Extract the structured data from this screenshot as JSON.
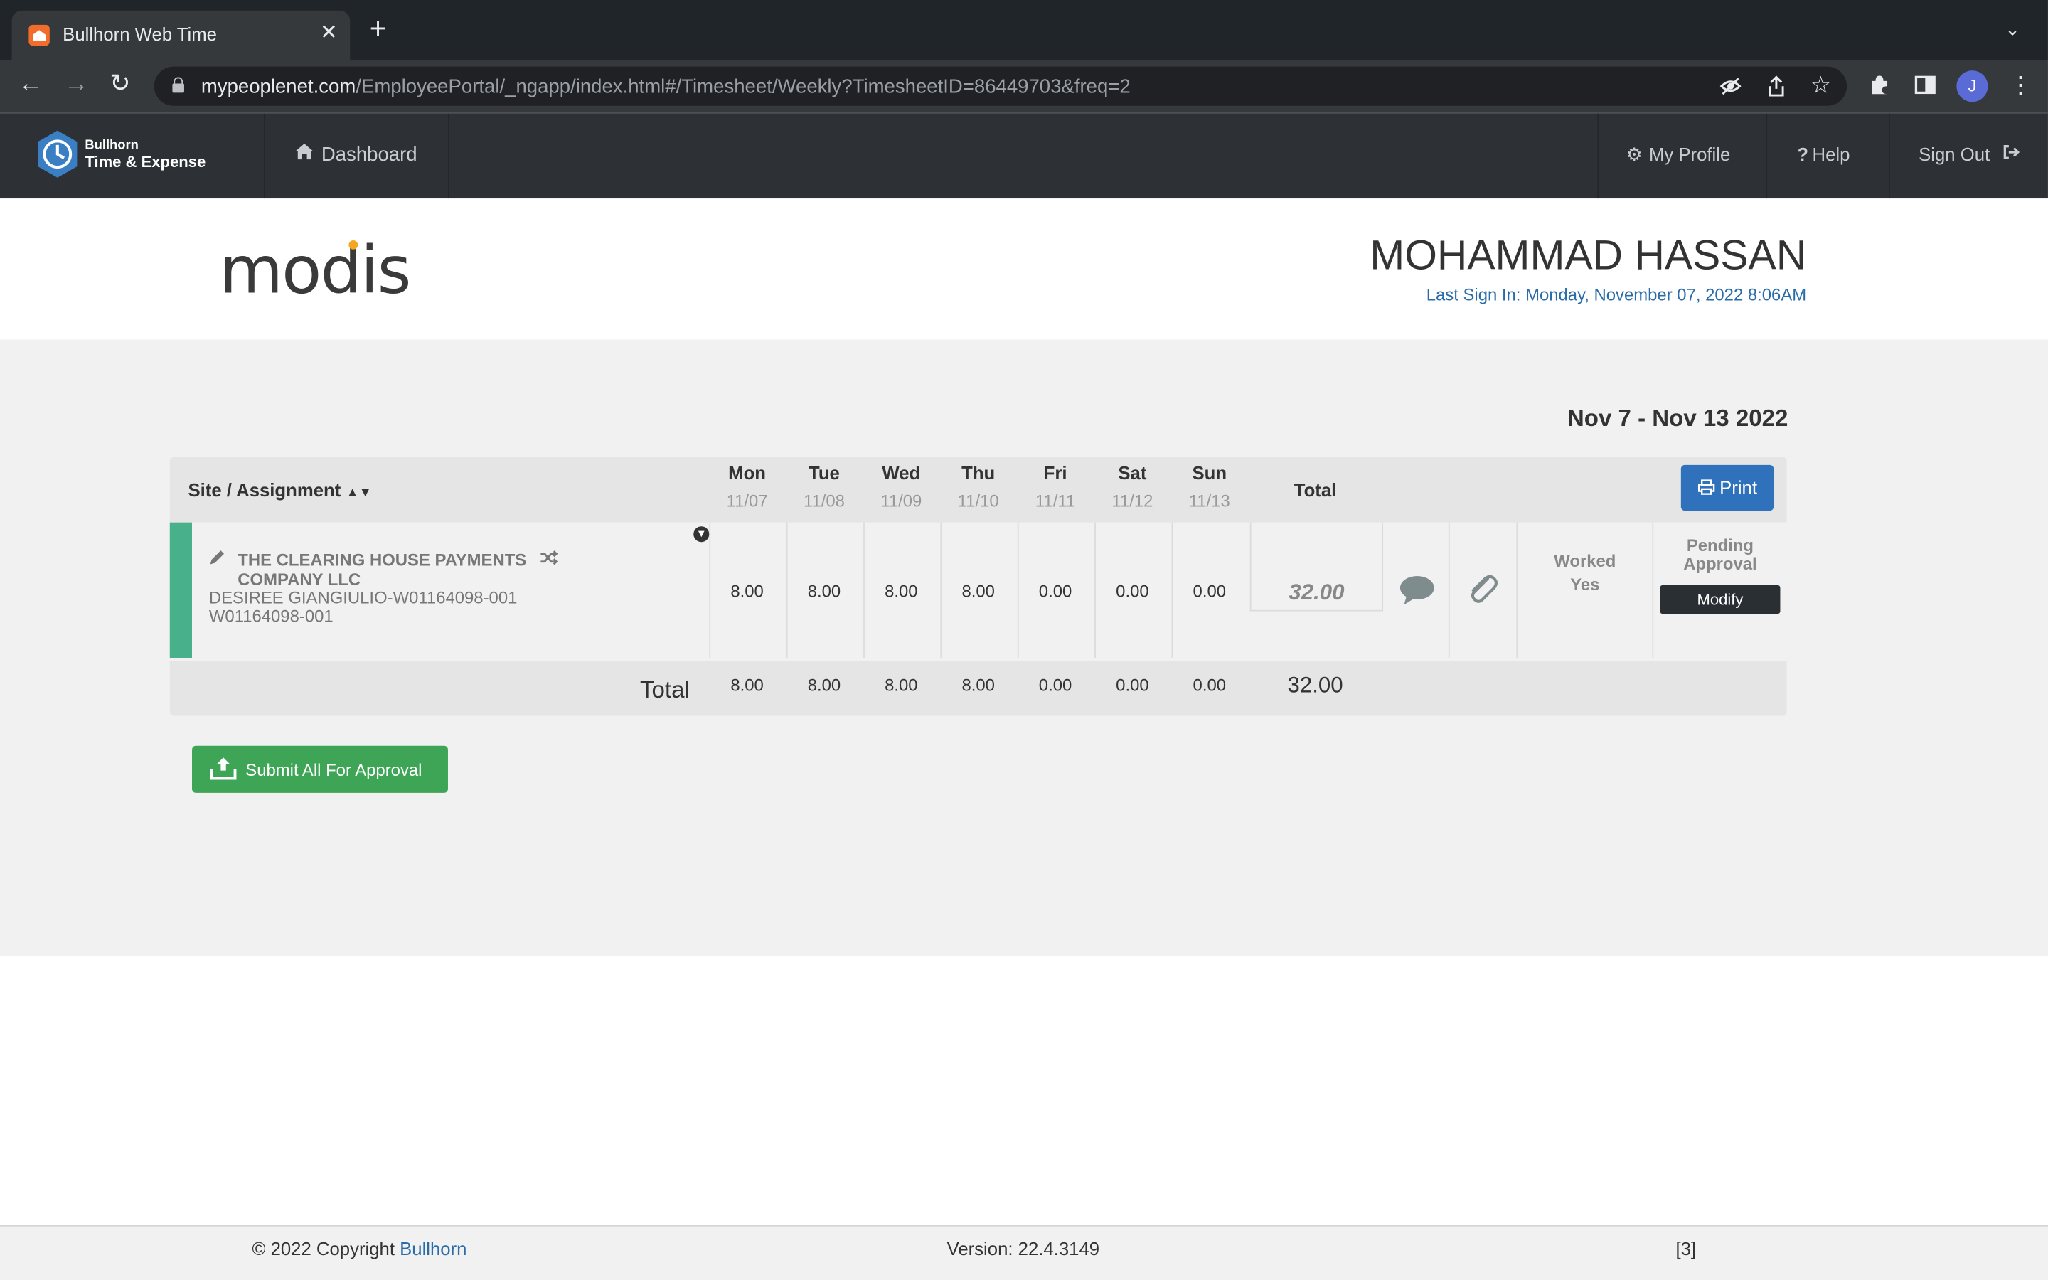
{
  "browser": {
    "tab_title": "Bullhorn Web Time",
    "url_host": "mypeoplenet.com",
    "url_path": "/EmployeePortal/_ngapp/index.html#/Timesheet/Weekly?TimesheetID=86449703&freq=2",
    "profile_initial": "J"
  },
  "app": {
    "brand_small": "Bullhorn",
    "brand_big": "Time & Expense",
    "nav": {
      "dashboard": "Dashboard",
      "my_profile": "My Profile",
      "help": "Help",
      "sign_out": "Sign Out"
    }
  },
  "banner": {
    "company_logo": "modis",
    "user_name": "MOHAMMAD HASSAN",
    "last_sign_in": "Last Sign In: Monday, November 07, 2022 8:06AM"
  },
  "timesheet": {
    "week_range": "Nov 7 - Nov 13 2022",
    "site_header": "Site / Assignment",
    "total_header": "Total",
    "print_label": "Print",
    "days": [
      {
        "name": "Mon",
        "date": "11/07"
      },
      {
        "name": "Tue",
        "date": "11/08"
      },
      {
        "name": "Wed",
        "date": "11/09"
      },
      {
        "name": "Thu",
        "date": "11/10"
      },
      {
        "name": "Fri",
        "date": "11/11"
      },
      {
        "name": "Sat",
        "date": "11/12"
      },
      {
        "name": "Sun",
        "date": "11/13"
      }
    ],
    "row": {
      "company_line1": "THE CLEARING HOUSE PAYMENTS",
      "company_line2": "COMPANY LLC",
      "assignment": "DESIREE GIANGIULIO-W01164098-001",
      "assignment_id": "W01164098-001",
      "hours": [
        "8.00",
        "8.00",
        "8.00",
        "8.00",
        "0.00",
        "0.00",
        "0.00"
      ],
      "total": "32.00",
      "worked_label": "Worked",
      "worked_value": "Yes",
      "status": "Pending Approval",
      "modify_label": "Modify"
    },
    "totals": {
      "label": "Total",
      "hours": [
        "8.00",
        "8.00",
        "8.00",
        "8.00",
        "0.00",
        "0.00",
        "0.00"
      ],
      "sum": "32.00"
    },
    "submit_label": "Submit All For Approval"
  },
  "footer": {
    "copyright": "© 2022 Copyright",
    "copyright_link": "Bullhorn",
    "version": "Version: 22.4.3149",
    "counter": "[3]"
  },
  "colors": {
    "accent_blue": "#2f72bb",
    "submit_green": "#3ea556",
    "row_accent": "#48b08a"
  }
}
